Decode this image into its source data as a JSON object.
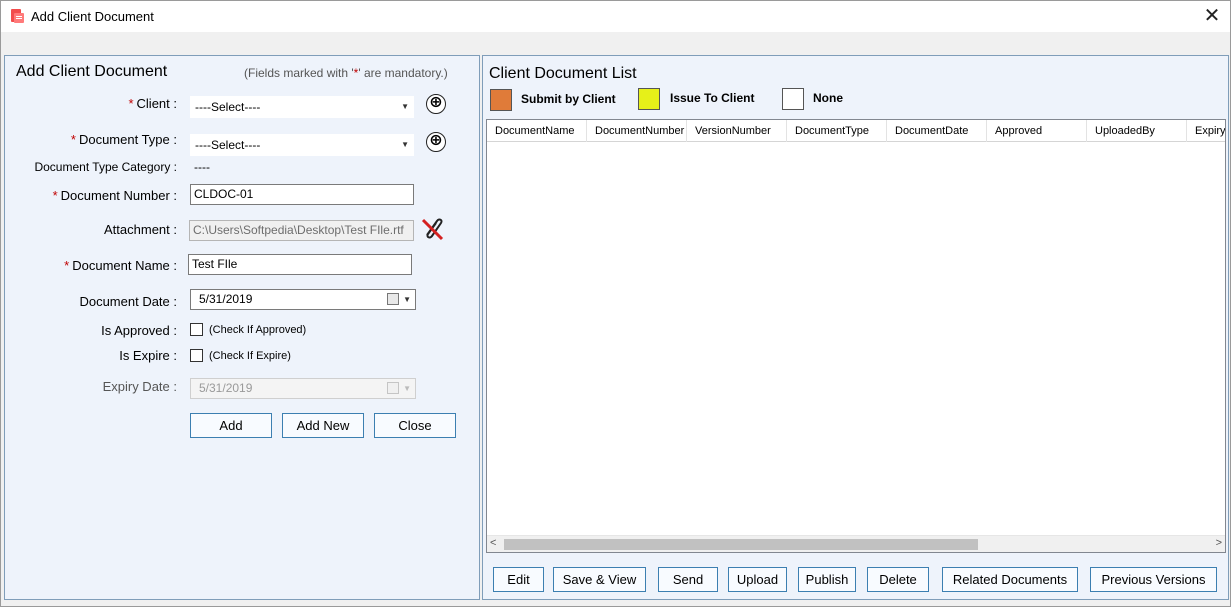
{
  "window": {
    "title": "Add Client Document",
    "close_symbol": "✕"
  },
  "form": {
    "title": "Add Client Document",
    "mandatory_note_prefix": "(Fields marked with '",
    "mandatory_note_star": "*",
    "mandatory_note_suffix": "' are mandatory.)",
    "client": {
      "label": "Client :",
      "value": "----Select----"
    },
    "document_type": {
      "label": "Document Type :",
      "value": "----Select----"
    },
    "document_type_category": {
      "label": "Document Type Category :",
      "value": "----"
    },
    "document_number": {
      "label": "Document Number :",
      "value": "CLDOC-01"
    },
    "attachment": {
      "label": "Attachment :",
      "value": "C:\\Users\\Softpedia\\Desktop\\Test FIle.rtf"
    },
    "document_name": {
      "label": "Document Name :",
      "value": "Test FIle"
    },
    "document_date": {
      "label": "Document Date :",
      "value": "5/31/2019"
    },
    "is_approved": {
      "label": "Is Approved :",
      "checkbox_text": "(Check If Approved)",
      "checked": false
    },
    "is_expire": {
      "label": "Is Expire :",
      "checkbox_text": "(Check If Expire)",
      "checked": false
    },
    "expiry_date": {
      "label": "Expiry Date :",
      "value": "5/31/2019"
    },
    "required_marker": "*",
    "buttons": {
      "add": "Add",
      "add_new": "Add New",
      "close": "Close"
    }
  },
  "list": {
    "title": "Client Document List",
    "legend": [
      {
        "label": "Submit by Client",
        "color": "#e07b39"
      },
      {
        "label": "Issue To Client",
        "color": "#e6f019"
      },
      {
        "label": "None",
        "color": "#ffffff"
      }
    ],
    "columns": [
      "DocumentName",
      "DocumentNumber",
      "VersionNumber",
      "DocumentType",
      "DocumentDate",
      "Approved",
      "UploadedBy",
      "ExpiryD"
    ],
    "rows": [],
    "scroll_left": "<",
    "scroll_right": ">",
    "buttons": {
      "edit": "Edit",
      "save_view": "Save & View",
      "send": "Send",
      "upload": "Upload",
      "publish": "Publish",
      "delete": "Delete",
      "related_documents": "Related Documents",
      "previous_versions": "Previous Versions"
    }
  },
  "icons": {
    "app": "app-document-icon",
    "plus": "⊕",
    "paperclip_remove": "remove-attachment-icon"
  }
}
